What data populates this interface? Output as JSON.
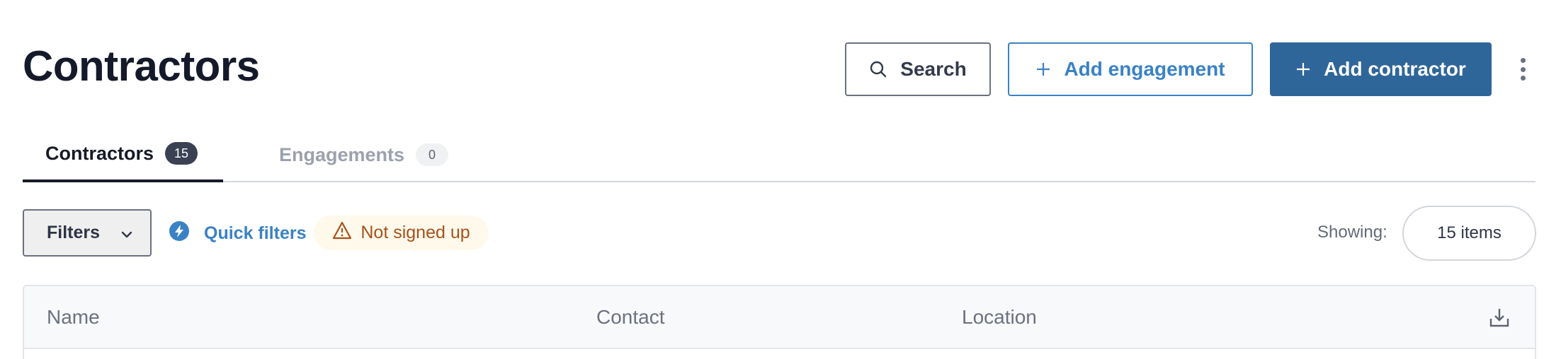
{
  "header": {
    "title": "Contractors",
    "search_label": "Search",
    "search_icon": "search-icon",
    "add_engagement_label": "Add engagement",
    "add_contractor_label": "Add contractor",
    "more_icon": "kebab-menu-icon"
  },
  "tabs": [
    {
      "label": "Contractors",
      "count": "15",
      "active": true
    },
    {
      "label": "Engagements",
      "count": "0",
      "active": false
    }
  ],
  "toolbar": {
    "filters_label": "Filters",
    "quick_filters_label": "Quick filters",
    "quick_filter_pills": [
      {
        "label": "Not signed up",
        "icon": "warning-icon"
      }
    ],
    "showing_label": "Showing:",
    "showing_value": "15 items"
  },
  "table": {
    "columns": [
      "Name",
      "Contact",
      "Location"
    ],
    "download_icon": "download-icon"
  },
  "colors": {
    "primary": "#2f6699",
    "link": "#3a82c4",
    "warning_text": "#a6511c",
    "warning_bg": "#fef9ea",
    "text_dark": "#151a2a"
  }
}
